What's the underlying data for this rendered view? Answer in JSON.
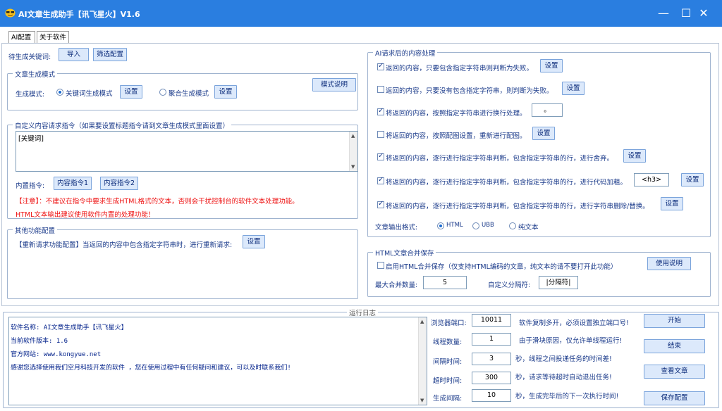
{
  "window": {
    "title": "AI文章生成助手【讯飞星火】V1.6",
    "minimize": "—",
    "maximize": "☐",
    "close": "✕"
  },
  "tabs": [
    {
      "label": "AI配置"
    },
    {
      "label": "关于软件"
    }
  ],
  "left": {
    "keyword_label": "待生成关键词:",
    "import_btn": "导入",
    "filter_btn": "筛选配置",
    "mode_group": {
      "title": "文章生成模式",
      "mode_label": "生成模式:",
      "opt1": "关键词生成模式",
      "opt1_setting": "设置",
      "opt2": "聚合生成模式",
      "opt2_setting": "设置",
      "explain_btn": "模式说明"
    },
    "custom_group": {
      "title": "自定义内容请求指令（如果要设置标题指令请到文章生成模式里面设置）",
      "textarea_value": "[关键词]",
      "builtin_label": "内置指令:",
      "builtin1": "内容指令1",
      "builtin2": "内容指令2",
      "note1": "【注意】：不建议在指令中要求生成HTML格式的文本，否则会干扰控制台的软件文本处理功能。",
      "note2": "HTML文本输出建议使用软件内置的处理功能！"
    },
    "other_group": {
      "title": "其他功能配置",
      "retry_text": "【重新请求功能配置】当返回的内容中包含指定字符串时，进行重新请求:",
      "retry_btn": "设置"
    }
  },
  "right": {
    "post_group": {
      "title": "AI请求后的内容处理",
      "rows": [
        {
          "checked": true,
          "text": "返回的内容，只要包含指定字符串则判断为失败。",
          "button": "设置",
          "input": ""
        },
        {
          "checked": false,
          "text": "返回的内容，只要没有包含指定字符串，则判断为失败。",
          "button": "设置",
          "input": ""
        },
        {
          "checked": true,
          "text": "将返回的内容，按照指定字符串进行换行处理。",
          "button": "",
          "input": "。"
        },
        {
          "checked": false,
          "text": "将返回的内容，按照配图设置，重新进行配图。",
          "button": "设置",
          "input": ""
        },
        {
          "checked": true,
          "text": "将返回的内容，逐行进行指定字符串判断，包含指定字符串的行，进行舍弃。",
          "button": "设置",
          "input": ""
        },
        {
          "checked": true,
          "text": "将返回的内容，逐行进行指定字符串判断，包含指定字符串的行，进行代码加粗。",
          "button": "设置",
          "input": "<h3>"
        },
        {
          "checked": true,
          "text": "将返回的内容，逐行进行指定字符串判断，包含指定字符串的行，进行字符串删除/替换。",
          "button": "设置",
          "input": ""
        }
      ],
      "format_label": "文章输出格式:",
      "format_opts": [
        "HTML",
        "UBB",
        "纯文本"
      ]
    },
    "merge_group": {
      "title": "HTML文章合并保存",
      "merge_cb": "启用HTML合并保存（仅支持HTML编码的文章，纯文本的请不要打开此功能）",
      "help_btn": "使用说明",
      "max_label": "最大合并数量:",
      "max_value": "5",
      "sep_label": "自定义分隔符:",
      "sep_value": "|分隔符|"
    }
  },
  "log": {
    "title": "运行日志",
    "lines": [
      "软件名称: AI文章生成助手【讯飞星火】",
      "当前软件版本: 1.6",
      "官方网站: www.kongyue.net",
      "感谢您选择使用我们空月科技开发的软件 ，您在使用过程中有任何疑问和建议，可以及时联系我们!"
    ],
    "port_label": "浏览器端口:",
    "port_value": "10011",
    "port_note": "软件复制多开，必须设置独立端口号!",
    "thread_label": "线程数量:",
    "thread_value": "1",
    "thread_note": "由于滑块原因，仅允许单线程运行!",
    "interval_label": "间隔时间:",
    "interval_value": "3",
    "interval_note": "秒，线程之间投递任务的时间差!",
    "timeout_label": "超时时间:",
    "timeout_value": "300",
    "timeout_note": "秒，请求等待超时自动退出任务!",
    "gen_label": "生成间隔:",
    "gen_value": "10",
    "gen_note": "秒，生成完毕后的下一次执行时间!",
    "start_btn": "开始",
    "stop_btn": "结束",
    "view_btn": "查看文章",
    "save_btn": "保存配置"
  }
}
